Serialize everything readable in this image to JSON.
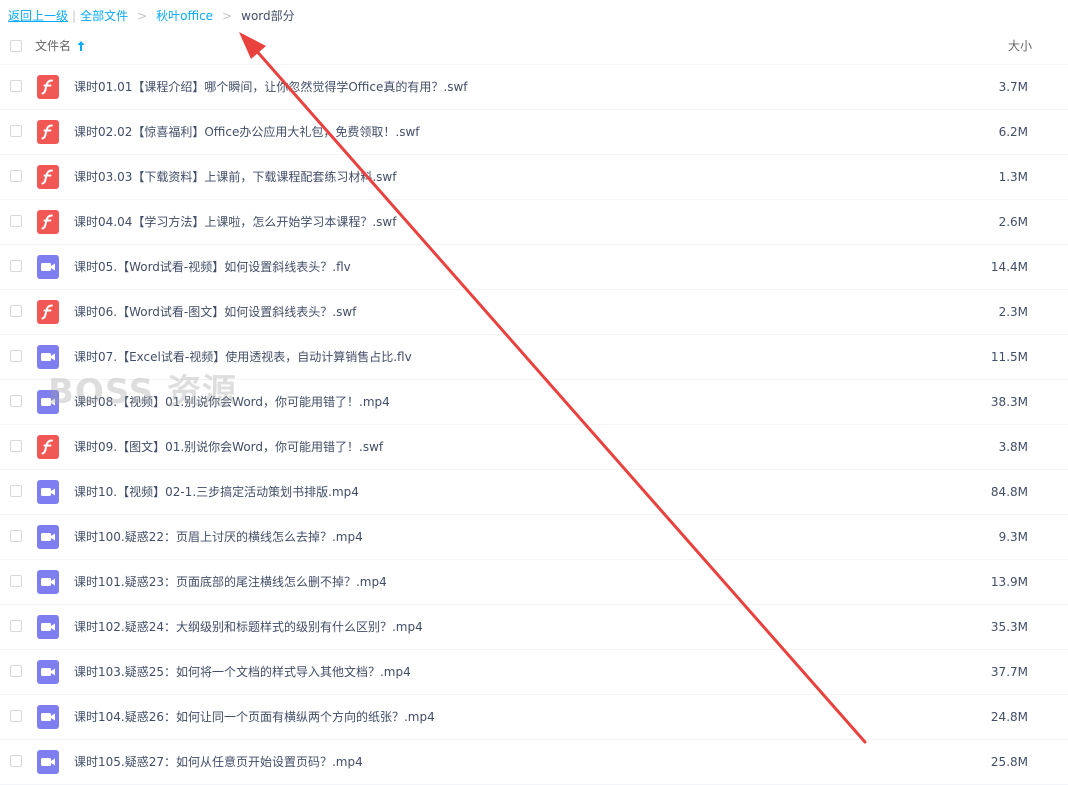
{
  "breadcrumb": {
    "back": "返回上一级",
    "separator": "|",
    "items": [
      "全部文件",
      "秋叶office"
    ],
    "arrow": ">",
    "current": "word部分"
  },
  "header": {
    "name_label": "文件名",
    "sort_icon": "arrow-up-icon",
    "size_label": "大小"
  },
  "colors": {
    "link": "#09aaff",
    "flash_icon": "#f15855",
    "video_icon": "#7f7ef0",
    "annotation_arrow": "#e8413e"
  },
  "files": [
    {
      "name": "课时01.01【课程介绍】哪个瞬间，让你忽然觉得学Office真的有用？.swf",
      "size": "3.7M",
      "type": "flash"
    },
    {
      "name": "课时02.02【惊喜福利】Office办公应用大礼包，免费领取！.swf",
      "size": "6.2M",
      "type": "flash"
    },
    {
      "name": "课时03.03【下载资料】上课前，下载课程配套练习材料.swf",
      "size": "1.3M",
      "type": "flash"
    },
    {
      "name": "课时04.04【学习方法】上课啦，怎么开始学习本课程？.swf",
      "size": "2.6M",
      "type": "flash"
    },
    {
      "name": "课时05.【Word试看-视频】如何设置斜线表头？.flv",
      "size": "14.4M",
      "type": "video"
    },
    {
      "name": "课时06.【Word试看-图文】如何设置斜线表头？.swf",
      "size": "2.3M",
      "type": "flash"
    },
    {
      "name": "课时07.【Excel试看-视频】使用透视表，自动计算销售占比.flv",
      "size": "11.5M",
      "type": "video"
    },
    {
      "name": "课时08.【视频】01.别说你会Word，你可能用错了！.mp4",
      "size": "38.3M",
      "type": "video"
    },
    {
      "name": "课时09.【图文】01.别说你会Word，你可能用错了！.swf",
      "size": "3.8M",
      "type": "flash"
    },
    {
      "name": "课时10.【视频】02-1.三步搞定活动策划书排版.mp4",
      "size": "84.8M",
      "type": "video"
    },
    {
      "name": "课时100.疑惑22：页眉上讨厌的横线怎么去掉？.mp4",
      "size": "9.3M",
      "type": "video"
    },
    {
      "name": "课时101.疑惑23：页面底部的尾注横线怎么删不掉？.mp4",
      "size": "13.9M",
      "type": "video"
    },
    {
      "name": "课时102.疑惑24：大纲级别和标题样式的级别有什么区别？.mp4",
      "size": "35.3M",
      "type": "video"
    },
    {
      "name": "课时103.疑惑25：如何将一个文档的样式导入其他文档？.mp4",
      "size": "37.7M",
      "type": "video"
    },
    {
      "name": "课时104.疑惑26：如何让同一个页面有横纵两个方向的纸张？.mp4",
      "size": "24.8M",
      "type": "video"
    },
    {
      "name": "课时105.疑惑27：如何从任意页开始设置页码？.mp4",
      "size": "25.8M",
      "type": "video"
    }
  ],
  "watermark": "BOSS 资源"
}
